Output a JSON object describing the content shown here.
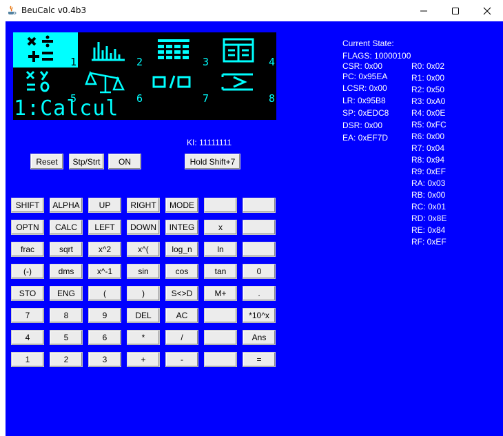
{
  "window": {
    "title": "BeuCalc v0.4b3",
    "controls": {
      "minimize": "minimize-icon",
      "maximize": "maximize-icon",
      "close": "close-icon"
    }
  },
  "display": {
    "modes": [
      {
        "number": "1",
        "icon": "calc-icon",
        "selected": true
      },
      {
        "number": "2",
        "icon": "bar-chart-icon",
        "selected": false
      },
      {
        "number": "3",
        "icon": "table-icon",
        "selected": false
      },
      {
        "number": "4",
        "icon": "spreadsheet-icon",
        "selected": false
      },
      {
        "number": "5",
        "icon": "xy-equation-icon",
        "selected": false
      },
      {
        "number": "6",
        "icon": "balance-icon",
        "selected": false
      },
      {
        "number": "7",
        "icon": "fraction-icon",
        "selected": false
      },
      {
        "number": "8",
        "icon": "arrow-box-icon",
        "selected": false
      }
    ],
    "text": "1:Calcul",
    "foreground": "#00ffff",
    "background": "#000000"
  },
  "ki_status": "KI: 11111111",
  "control_buttons": {
    "reset": "Reset",
    "stp_strt": "Stp/Strt",
    "on": "ON",
    "hold": "Hold Shift+7"
  },
  "keypad": [
    [
      "SHIFT",
      "ALPHA",
      "UP",
      "RIGHT",
      "MODE",
      "",
      ""
    ],
    [
      "OPTN",
      "CALC",
      "LEFT",
      "DOWN",
      "INTEG",
      "x",
      ""
    ],
    [
      "frac",
      "sqrt",
      "x^2",
      "x^(",
      "log_n",
      "ln",
      ""
    ],
    [
      "(-)",
      "dms",
      "x^-1",
      "sin",
      "cos",
      "tan",
      "0"
    ],
    [
      "STO",
      "ENG",
      "(",
      ")",
      "S<>D",
      "M+",
      "."
    ],
    [
      "7",
      "8",
      "9",
      "DEL",
      "AC",
      "",
      "*10^x"
    ],
    [
      "4",
      "5",
      "6",
      "*",
      "/",
      "",
      "Ans"
    ],
    [
      "1",
      "2",
      "3",
      "+",
      "-",
      "",
      "="
    ]
  ],
  "state": {
    "heading": "Current State:",
    "flags": "FLAGS: 10000100",
    "left_regs": [
      "CSR: 0x00",
      "PC: 0x95EA",
      "LCSR: 0x00",
      "LR: 0x95B8",
      "SP: 0xEDC8",
      "DSR: 0x00",
      "EA: 0xEF7D"
    ],
    "right_regs": [
      "R0: 0x02",
      "R1: 0x00",
      "R2: 0x50",
      "R3: 0xA0",
      "R4: 0x0E",
      "R5: 0xFC",
      "R6: 0x00",
      "R7: 0x04",
      "R8: 0x94",
      "R9: 0xEF",
      "RA: 0x03",
      "RB: 0x00",
      "RC: 0x01",
      "RD: 0x8E",
      "RE: 0x84",
      "RF: 0xEF"
    ]
  },
  "colors": {
    "client_bg": "#0000ff",
    "lcd_fg": "#00ffff",
    "button_bg": "#ececec"
  }
}
